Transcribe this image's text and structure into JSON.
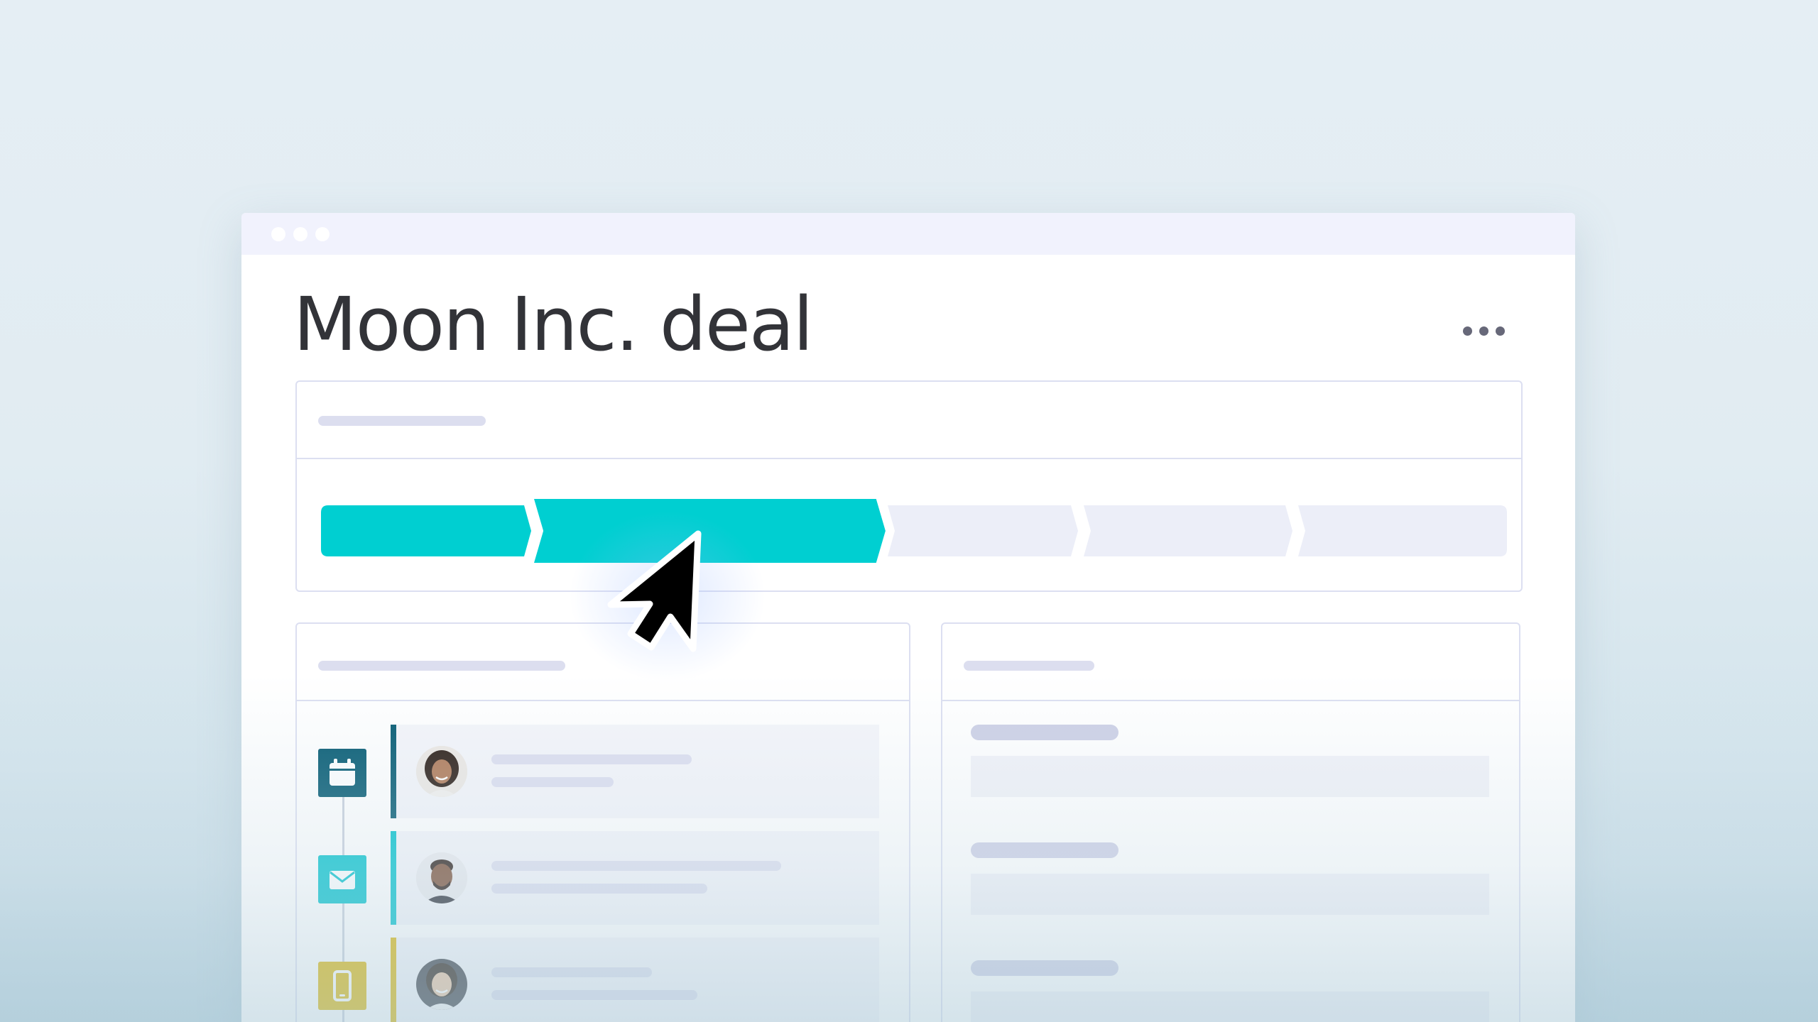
{
  "window": {
    "controls": [
      "dot",
      "dot",
      "dot"
    ]
  },
  "page": {
    "title": "Moon Inc. deal"
  },
  "menu": {
    "icon": "more-horizontal-icon"
  },
  "pipeline": {
    "stages": [
      {
        "state": "completed",
        "color": "#00cfd1"
      },
      {
        "state": "active",
        "color": "#00cfd1"
      },
      {
        "state": "pending",
        "color": "#eceef8"
      },
      {
        "state": "pending",
        "color": "#eceef8"
      },
      {
        "state": "pending",
        "color": "#eceef8"
      }
    ]
  },
  "activity": {
    "items": [
      {
        "icon": "calendar-icon",
        "color": "#045a72",
        "avatar": "woman-avatar"
      },
      {
        "icon": "mail-icon",
        "color": "#00c2cc",
        "avatar": "man-avatar"
      },
      {
        "icon": "phone-icon",
        "color": "#dcb608",
        "avatar": "woman-avatar"
      }
    ]
  },
  "colors": {
    "accent": "#00cfd1",
    "title_text": "#323338",
    "border": "#dcdff1"
  },
  "cursor": {
    "icon": "pointer-cursor-icon"
  }
}
